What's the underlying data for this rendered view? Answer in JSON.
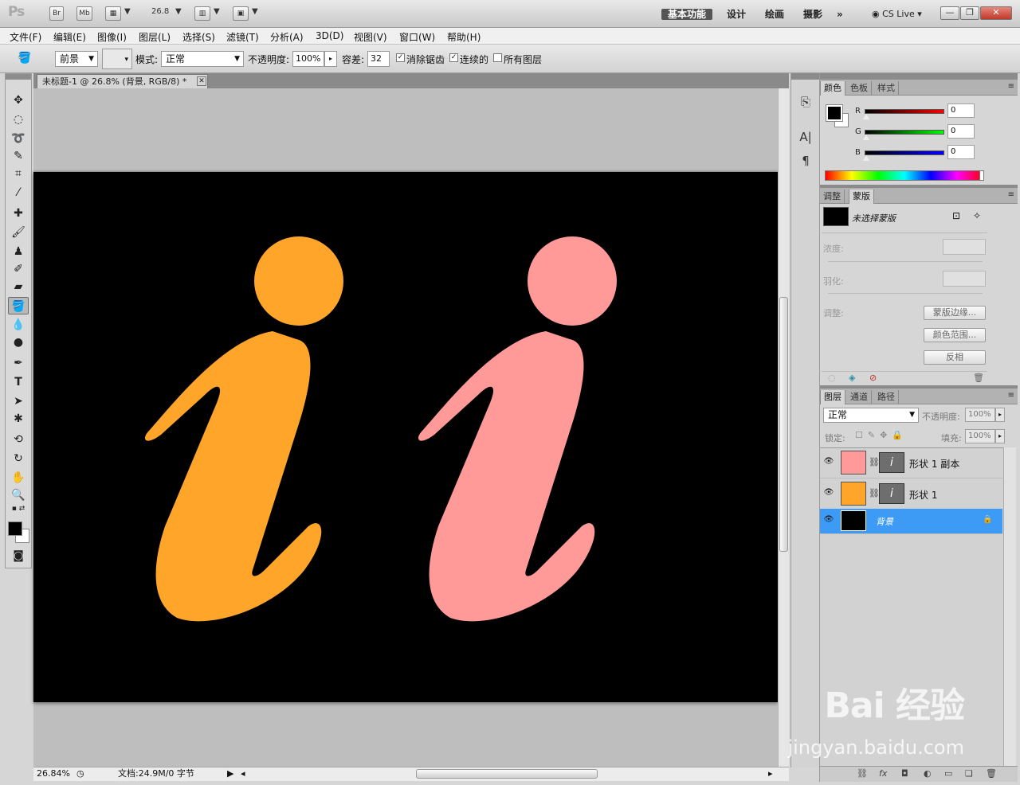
{
  "app": {
    "logo": "Ps",
    "bridge_btn": "Br",
    "minibridge_btn": "Mb",
    "zoom_value": "26.8",
    "workspaces": [
      "基本功能",
      "设计",
      "绘画",
      "摄影"
    ],
    "more": "»",
    "cslive": "CS Live"
  },
  "menu": [
    "文件(F)",
    "编辑(E)",
    "图像(I)",
    "图层(L)",
    "选择(S)",
    "滤镜(T)",
    "分析(A)",
    "3D(D)",
    "视图(V)",
    "窗口(W)",
    "帮助(H)"
  ],
  "options": {
    "fill_source": "前景",
    "mode_label": "模式:",
    "mode_value": "正常",
    "opacity_label": "不透明度:",
    "opacity_value": "100%",
    "tolerance_label": "容差:",
    "tolerance_value": "32",
    "antialias_label": "消除锯齿",
    "contiguous_label": "连续的",
    "alllayers_label": "所有图层"
  },
  "document": {
    "tab_title": "未标题-1 @ 26.8% (背景, RGB/8) *",
    "zoom_status": "26.84%",
    "doc_status": "文档:24.9M/0 字节"
  },
  "canvas": {
    "background": "#000000",
    "shape_left_color": "#ffa52a",
    "shape_right_color": "#ff9a99"
  },
  "color_panel": {
    "tabs": [
      "颜色",
      "色板",
      "样式"
    ],
    "channels": [
      {
        "label": "R",
        "value": "0"
      },
      {
        "label": "G",
        "value": "0"
      },
      {
        "label": "B",
        "value": "0"
      }
    ]
  },
  "masks_panel": {
    "tabs": [
      "调整",
      "蒙版"
    ],
    "status": "未选择蒙版",
    "density_label": "浓度:",
    "feather_label": "羽化:",
    "refine_label": "调整:",
    "btn_mask_edge": "蒙版边缘...",
    "btn_color_range": "颜色范围...",
    "btn_invert": "反相"
  },
  "layers_panel": {
    "tabs": [
      "图层",
      "通道",
      "路径"
    ],
    "blend_mode": "正常",
    "opacity_label": "不透明度:",
    "opacity_value": "100%",
    "lock_label": "锁定:",
    "fill_label": "填充:",
    "fill_value": "100%",
    "layers": [
      {
        "name": "形状 1 副本",
        "color": "#ff9a99",
        "selected": false
      },
      {
        "name": "形状 1",
        "color": "#ffa52a",
        "selected": false
      },
      {
        "name": "背景",
        "color": "#000000",
        "selected": true
      }
    ]
  },
  "watermark": {
    "brand": "Bai 经验",
    "site": "jingyan.baidu.com"
  }
}
